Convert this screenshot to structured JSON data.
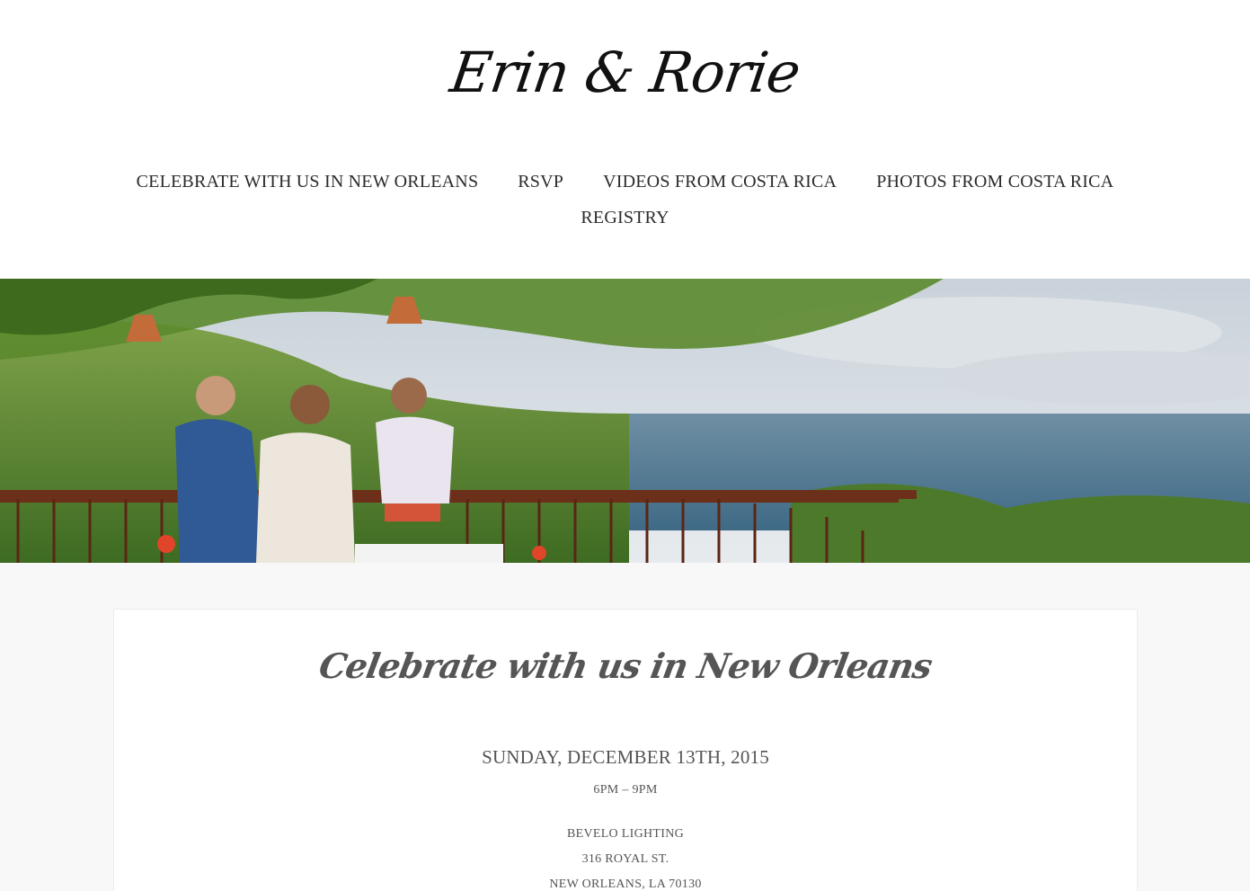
{
  "site": {
    "logo_text": "Erin & Rorie"
  },
  "nav": {
    "items": [
      {
        "label": "CELEBRATE WITH US IN NEW ORLEANS"
      },
      {
        "label": "RSVP"
      },
      {
        "label": "VIDEOS FROM COSTA RICA"
      },
      {
        "label": "PHOTOS FROM COSTA RICA"
      },
      {
        "label": "REGISTRY"
      }
    ]
  },
  "hero": {
    "description_icon": "photo-banner"
  },
  "content": {
    "title": "Celebrate with us in New Orleans",
    "date": "SUNDAY, DECEMBER 13TH, 2015",
    "time": "6PM – 9PM",
    "venue": {
      "name": "BEVELO LIGHTING",
      "street": "316 ROYAL ST.",
      "city": "NEW ORLEANS, LA 70130"
    }
  },
  "colors": {
    "header_bg": "#ffffff",
    "page_bg": "#f8f8f8",
    "text": "#333333",
    "muted_text": "#555555"
  }
}
